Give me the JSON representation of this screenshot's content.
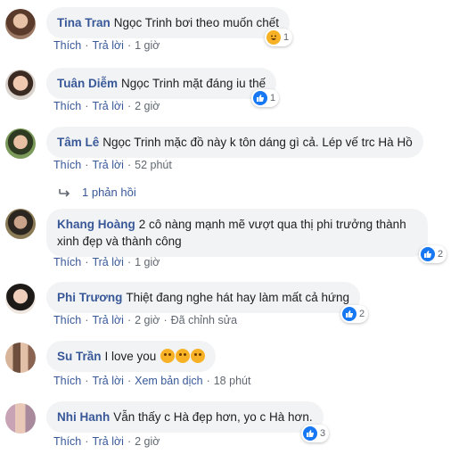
{
  "comments": [
    {
      "author": "Tina Tran",
      "text": "Ngọc Trinh bơi theo muốn chết",
      "actions": {
        "like": "Thích",
        "reply": "Trả lời",
        "time": "1 giờ"
      },
      "reaction": {
        "type": "haha-icon",
        "count": "1"
      }
    },
    {
      "author": "Tuân Diễm",
      "text": "Ngọc Trinh mặt đáng iu thế",
      "actions": {
        "like": "Thích",
        "reply": "Trả lời",
        "time": "2 giờ"
      },
      "reaction": {
        "type": "like-icon",
        "count": "1"
      }
    },
    {
      "author": "Tâm Lê",
      "text": "Ngọc Trinh mặc đồ này k tôn dáng gì cả. Lép vế trc Hà Hồ",
      "actions": {
        "like": "Thích",
        "reply": "Trả lời",
        "time": "52 phút"
      },
      "replies": "1 phản hồi"
    },
    {
      "author": "Khang Hoàng",
      "text": "2 cô nàng mạnh mẽ vượt qua thị phi trưởng thành xinh đẹp và thành công",
      "actions": {
        "like": "Thích",
        "reply": "Trả lời",
        "time": "1 giờ"
      },
      "reaction": {
        "type": "like-icon",
        "count": "2"
      }
    },
    {
      "author": "Phi Trương",
      "text": "Thiệt đang nghe hát hay làm mất cả hứng",
      "actions": {
        "like": "Thích",
        "reply": "Trả lời",
        "time": "2 giờ",
        "edited": "Đã chỉnh sửa"
      },
      "reaction": {
        "type": "like-icon",
        "count": "2"
      }
    },
    {
      "author": "Su Trần",
      "text": "I love you",
      "actions": {
        "like": "Thích",
        "reply": "Trả lời",
        "translate": "Xem bản dịch",
        "time": "18 phút"
      }
    },
    {
      "author": "Nhi Hanh",
      "text": "Vẫn thấy c Hà đẹp hơn, yo c Hà hơn.",
      "actions": {
        "like": "Thích",
        "reply": "Trả lời",
        "time": "2 giờ"
      },
      "reaction": {
        "type": "like-icon",
        "count": "3"
      }
    }
  ],
  "colors": {
    "link": "#385898",
    "bubble": "#f2f3f5",
    "meta": "#606770",
    "like": "#1877f2"
  }
}
